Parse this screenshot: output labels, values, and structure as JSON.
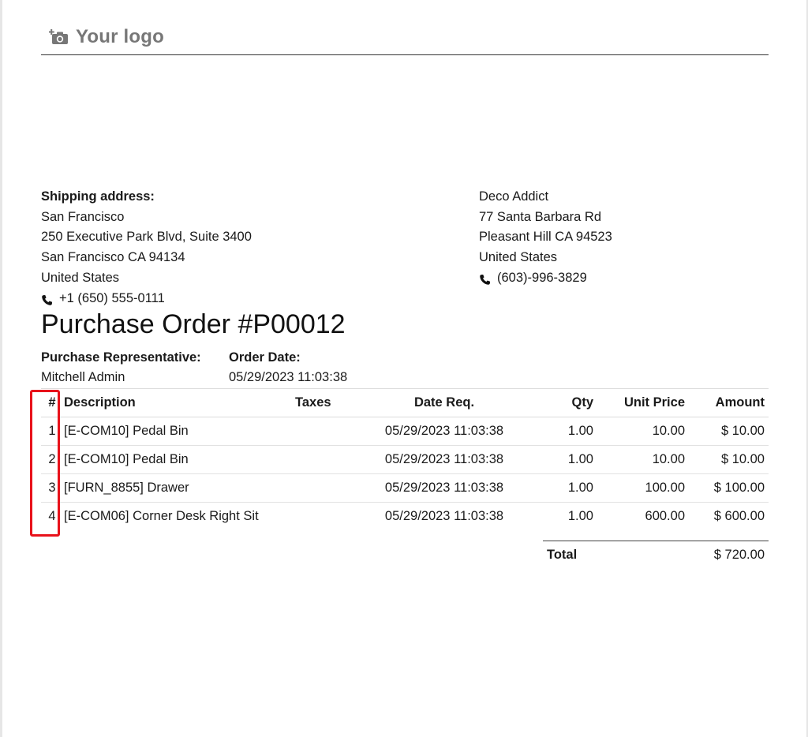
{
  "header": {
    "logo_text": "Your logo",
    "logo_icon": "camera-plus-icon"
  },
  "shipping": {
    "label": "Shipping address:",
    "lines": [
      "San Francisco",
      "250 Executive Park Blvd, Suite 3400",
      "San Francisco CA 94134",
      "United States"
    ],
    "phone": "+1 (650) 555-0111"
  },
  "vendor": {
    "lines": [
      "Deco Addict",
      "77 Santa Barbara Rd",
      "Pleasant Hill CA 94523",
      "United States"
    ],
    "phone": "(603)-996-3829"
  },
  "title": "Purchase Order #P00012",
  "info": {
    "rep_label": "Purchase Representative:",
    "rep_value": "Mitchell Admin",
    "date_label": "Order Date:",
    "date_value": "05/29/2023 11:03:38"
  },
  "table": {
    "headers": {
      "num": "#",
      "description": "Description",
      "taxes": "Taxes",
      "date_req": "Date Req.",
      "qty": "Qty",
      "unit_price": "Unit Price",
      "amount": "Amount"
    },
    "rows": [
      {
        "num": "1",
        "description": "[E-COM10] Pedal Bin",
        "taxes": "",
        "date_req": "05/29/2023 11:03:38",
        "qty": "1.00",
        "unit_price": "10.00",
        "amount": "$ 10.00"
      },
      {
        "num": "2",
        "description": "[E-COM10] Pedal Bin",
        "taxes": "",
        "date_req": "05/29/2023 11:03:38",
        "qty": "1.00",
        "unit_price": "10.00",
        "amount": "$ 10.00"
      },
      {
        "num": "3",
        "description": "[FURN_8855] Drawer",
        "taxes": "",
        "date_req": "05/29/2023 11:03:38",
        "qty": "1.00",
        "unit_price": "100.00",
        "amount": "$ 100.00"
      },
      {
        "num": "4",
        "description": "[E-COM06] Corner Desk Right Sit",
        "taxes": "",
        "date_req": "05/29/2023 11:03:38",
        "qty": "1.00",
        "unit_price": "600.00",
        "amount": "$ 600.00"
      }
    ]
  },
  "totals": {
    "label": "Total",
    "value": "$ 720.00"
  },
  "colors": {
    "highlight": "#e8121b",
    "logo": "#777777"
  }
}
